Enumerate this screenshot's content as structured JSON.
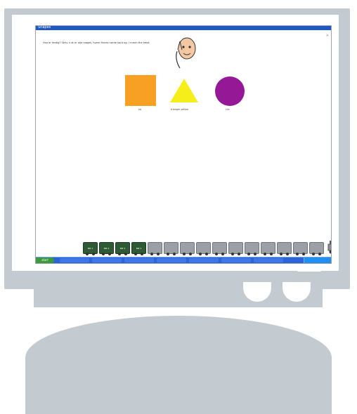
{
  "window": {
    "title": "Shapes"
  },
  "question": {
    "text": "Hva er ferdig? Skriv ri at er olje maget, hvem finnes nerde kant og. I mmm the tekst"
  },
  "shapes": [
    {
      "name": "square",
      "color": "#f8a024",
      "label": "sq"
    },
    {
      "name": "triangle",
      "color": "#f6ee1a",
      "label": "triangle yellow"
    },
    {
      "name": "circle",
      "color": "#951896",
      "label": "circ"
    }
  ],
  "train": {
    "cars": [
      {
        "style": "green",
        "label": "BM 1"
      },
      {
        "style": "green",
        "label": "BM 2"
      },
      {
        "style": "green",
        "label": "BM 3"
      },
      {
        "style": "green",
        "label": "BM 4"
      },
      {
        "style": "grey",
        "label": ""
      },
      {
        "style": "grey",
        "label": ""
      },
      {
        "style": "grey",
        "label": ""
      },
      {
        "style": "grey",
        "label": ""
      },
      {
        "style": "grey",
        "label": ""
      },
      {
        "style": "grey",
        "label": ""
      },
      {
        "style": "grey",
        "label": ""
      },
      {
        "style": "grey",
        "label": ""
      },
      {
        "style": "grey",
        "label": ""
      },
      {
        "style": "grey",
        "label": ""
      },
      {
        "style": "grey",
        "label": ""
      }
    ],
    "engine_icon": "locomotive-icon"
  },
  "taskbar": {
    "start_label": "start"
  },
  "colors": {
    "monitor": "#c4cbd0",
    "titlebar": "#1f57c6",
    "taskbar": "#2c63d6"
  }
}
